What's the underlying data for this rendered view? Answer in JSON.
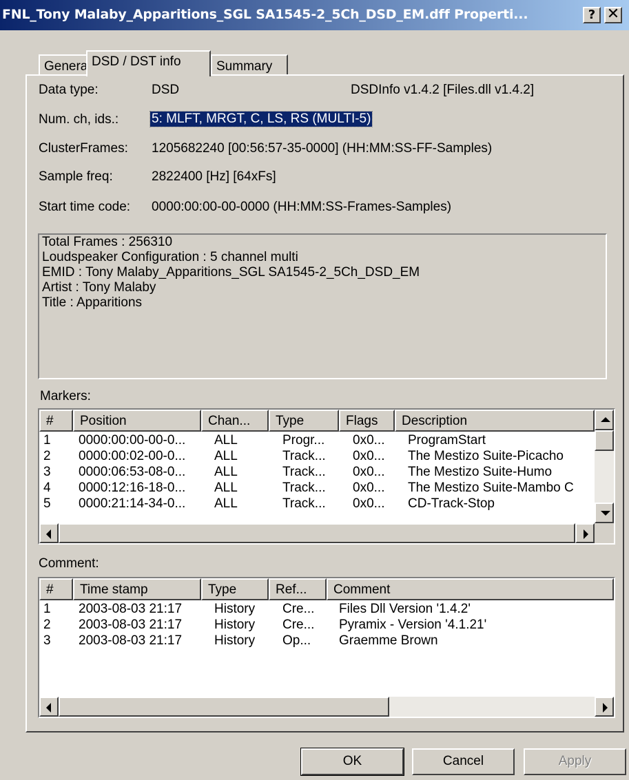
{
  "window": {
    "title": "FNL_Tony Malaby_Apparitions_SGL SA1545-2_5Ch_DSD_EM.dff Properti...",
    "help": "?",
    "close": "✕"
  },
  "tabs": [
    "General",
    "DSD / DST info",
    "Summary"
  ],
  "info": {
    "data_type_label": "Data type:",
    "data_type_value": "DSD",
    "version": "DSDInfo v1.4.2 [Files.dll v1.4.2]",
    "numch_label": "Num. ch, ids.:",
    "numch_value": "5:  MLFT, MRGT, C, LS, RS (MULTI-5)",
    "cluster_label": "ClusterFrames:",
    "cluster_value": "1205682240 [00:56:57-35-0000] (HH:MM:SS-FF-Samples)",
    "freq_label": "Sample freq:",
    "freq_value": "2822400 [Hz] [64xFs]",
    "start_label": "Start time code:",
    "start_value": "0000:00:00-00-0000 (HH:MM:SS-Frames-Samples)"
  },
  "textbox": [
    "Total Frames : 256310",
    "Loudspeaker Configuration : 5 channel multi",
    "EMID : Tony Malaby_Apparitions_SGL SA1545-2_5Ch_DSD_EM",
    "Artist : Tony Malaby",
    "Title : Apparitions"
  ],
  "markers": {
    "label": "Markers:",
    "columns": [
      "#",
      "Position",
      "Chan...",
      "Type",
      "Flags",
      "Description"
    ],
    "rows": [
      [
        "1",
        "0000:00:00-00-0...",
        "ALL",
        "Progr...",
        "0x0...",
        "ProgramStart"
      ],
      [
        "2",
        "0000:00:02-00-0...",
        "ALL",
        "Track...",
        "0x0...",
        "The Mestizo Suite-Picacho"
      ],
      [
        "3",
        "0000:06:53-08-0...",
        "ALL",
        "Track...",
        "0x0...",
        "The Mestizo Suite-Humo"
      ],
      [
        "4",
        "0000:12:16-18-0...",
        "ALL",
        "Track...",
        "0x0...",
        "The Mestizo Suite-Mambo C"
      ],
      [
        "5",
        "0000:21:14-34-0...",
        "ALL",
        "Track...",
        "0x0...",
        "CD-Track-Stop"
      ]
    ]
  },
  "comments": {
    "label": "Comment:",
    "columns": [
      "#",
      "Time stamp",
      "Type",
      "Ref...",
      "Comment"
    ],
    "rows": [
      [
        "1",
        "2003-08-03 21:17",
        "History",
        "Cre...",
        " Files Dll Version '1.4.2'"
      ],
      [
        "2",
        "2003-08-03 21:17",
        "History",
        "Cre...",
        "Pyramix - Version '4.1.21'"
      ],
      [
        "3",
        "2003-08-03 21:17",
        "History",
        "Op...",
        "Graemme Brown"
      ]
    ]
  },
  "buttons": {
    "ok": "OK",
    "cancel": "Cancel",
    "apply": "Apply"
  },
  "colors": {
    "title_start": "#0a246a",
    "title_end": "#a6caf0",
    "face": "#d4d0c8",
    "selection": "#0a246a"
  }
}
